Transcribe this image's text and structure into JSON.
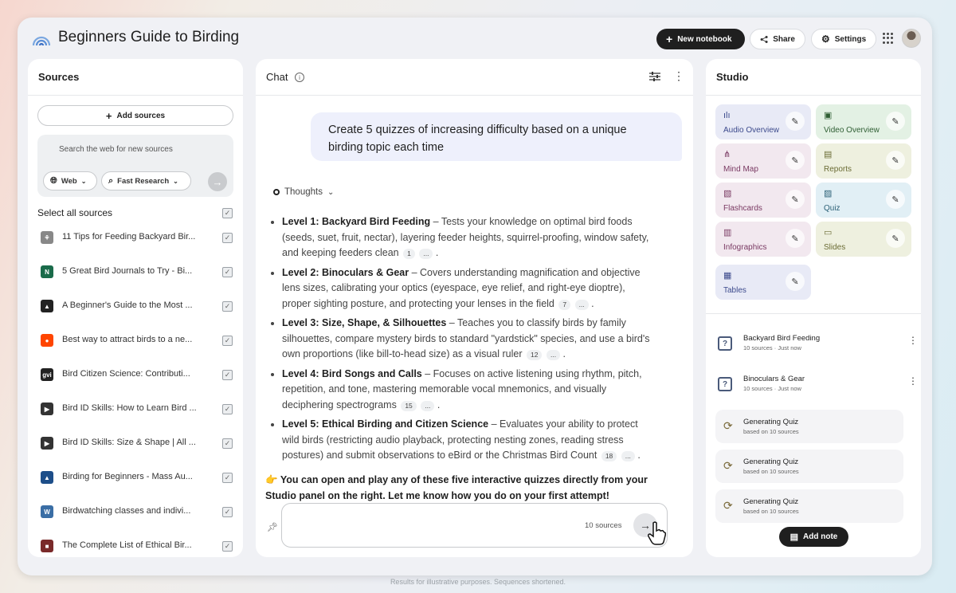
{
  "app": {
    "title": "Beginners Guide to Birding"
  },
  "header": {
    "new_notebook": "New notebook",
    "share": "Share",
    "settings": "Settings"
  },
  "sources_panel": {
    "title": "Sources",
    "add_sources": "Add sources",
    "search_placeholder": "Search the web for new sources",
    "web_pill": "Web",
    "research_pill": "Fast Research",
    "select_all": "Select all sources",
    "items": [
      {
        "label": "11 Tips for Feeding Backyard Bir...",
        "icon": "bird-sketch-icon",
        "color": "#888888"
      },
      {
        "label": "5 Great Bird Journals to Try - Bi...",
        "icon": "journal-site-icon",
        "color": "#1a6b4a"
      },
      {
        "label": "A Beginner's Guide to the Most ...",
        "icon": "audubon-icon",
        "color": "#222222"
      },
      {
        "label": "Best way to attract birds to a ne...",
        "icon": "reddit-icon",
        "color": "#ff4500"
      },
      {
        "label": "Bird Citizen Science: Contributi...",
        "icon": "gvi-icon",
        "color": "#222222"
      },
      {
        "label": "Bird ID Skills: How to Learn Bird ...",
        "icon": "bird-id-icon",
        "color": "#333333"
      },
      {
        "label": "Bird ID Skills: Size & Shape | All ...",
        "icon": "bird-id-icon",
        "color": "#333333"
      },
      {
        "label": "Birding for Beginners - Mass Au...",
        "icon": "mass-audubon-icon",
        "color": "#1d4e89"
      },
      {
        "label": "Birdwatching classes and indivi...",
        "icon": "wordpress-icon",
        "color": "#3a6ea5"
      },
      {
        "label": "The Complete List of Ethical Bir...",
        "icon": "ethical-birding-icon",
        "color": "#7a2a2a"
      }
    ]
  },
  "chat": {
    "title": "Chat",
    "user_message": "Create 5 quizzes of increasing difficulty based on a unique birding topic each time",
    "thoughts_label": "Thoughts",
    "levels": [
      {
        "heading": "Level 1: Backyard Bird Feeding",
        "text": " – Tests your knowledge on optimal bird foods (seeds, suet, fruit, nectar), layering feeder heights, squirrel-proofing, window safety, and keeping feeders clean",
        "cite": "1"
      },
      {
        "heading": "Level 2: Binoculars & Gear",
        "text": " – Covers understanding magnification and objective lens sizes, calibrating your optics (eyespace, eye relief, and right-eye dioptre), proper sighting posture, and protecting your lenses in the field",
        "cite": "7"
      },
      {
        "heading": "Level 3: Size, Shape, & Silhouettes",
        "text": " – Teaches you to classify birds by family silhouettes, compare mystery birds to standard \"yardstick\" species, and use a bird's own proportions (like bill-to-head size) as a visual ruler",
        "cite": "12"
      },
      {
        "heading": "Level 4: Bird Songs and Calls",
        "text": " – Focuses on active listening using rhythm, pitch, repetition, and tone, mastering memorable vocal mnemonics, and visually deciphering spectrograms",
        "cite": "15"
      },
      {
        "heading": "Level 5: Ethical Birding and Citizen Science",
        "text": " – Evaluates your ability to protect wild birds (restricting audio playback, protecting nesting zones, reading stress postures) and submit observations to eBird or the Christmas Bird Count",
        "cite": "18"
      }
    ],
    "cite_more": "...",
    "closing_emoji": "👉",
    "closing": "You can open and play any of these five interactive quizzes directly from your Studio panel on the right. Let me know how you do on your first attempt!",
    "source_count": "10 sources"
  },
  "studio": {
    "title": "Studio",
    "tiles": [
      {
        "label": "Audio Overview",
        "icon": "audio-overview-icon"
      },
      {
        "label": "Video Overview",
        "icon": "video-overview-icon"
      },
      {
        "label": "Mind Map",
        "icon": "mind-map-icon"
      },
      {
        "label": "Reports",
        "icon": "reports-icon"
      },
      {
        "label": "Flashcards",
        "icon": "flashcards-icon"
      },
      {
        "label": "Quiz",
        "icon": "quiz-icon"
      },
      {
        "label": "Infographics",
        "icon": "infographics-icon"
      },
      {
        "label": "Slides",
        "icon": "slides-icon"
      },
      {
        "label": "Tables",
        "icon": "tables-icon"
      }
    ],
    "notes": [
      {
        "title": "Backyard Bird Feeding",
        "sub": "10 sources · Just now"
      },
      {
        "title": "Binoculars & Gear",
        "sub": "10 sources · Just now"
      }
    ],
    "generating": [
      {
        "title": "Generating Quiz",
        "sub": "based on 10 sources"
      },
      {
        "title": "Generating Quiz",
        "sub": "based on 10 sources"
      },
      {
        "title": "Generating Quiz",
        "sub": "based on 10 sources"
      }
    ],
    "add_note": "Add note"
  },
  "footnote": "Results for illustrative purposes. Sequences shortened."
}
